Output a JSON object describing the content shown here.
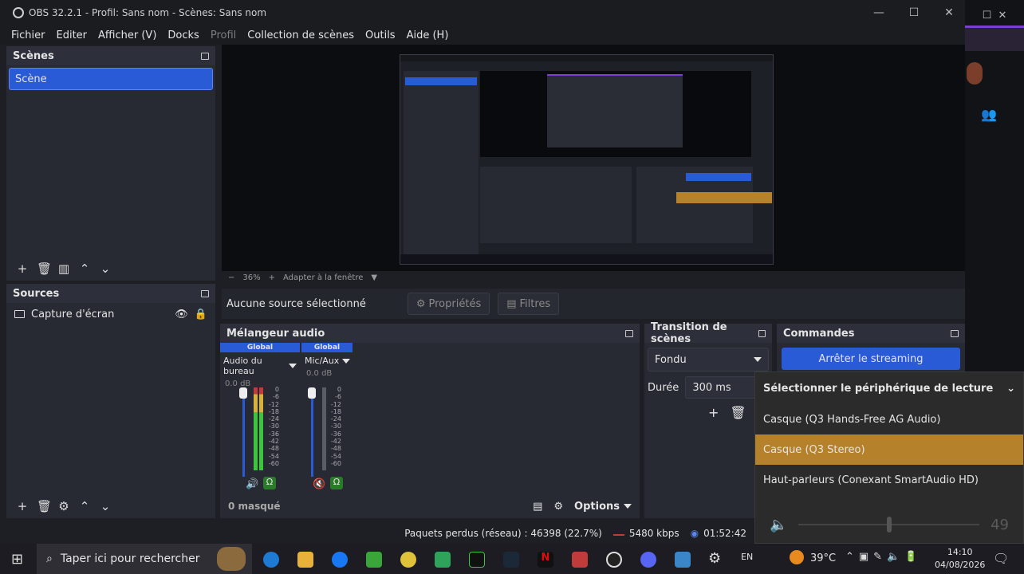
{
  "window": {
    "title": "OBS 32.2.1 - Profil: Sans nom - Scènes: Sans nom",
    "controls": [
      "—",
      "☐",
      "✕"
    ]
  },
  "menu": [
    "Fichier",
    "Editer",
    "Afficher (V)",
    "Docks",
    "Profil",
    "Collection de scènes",
    "Outils",
    "Aide (H)"
  ],
  "scenes": {
    "title": "Scènes",
    "items": [
      "Scène"
    ]
  },
  "sources": {
    "title": "Sources",
    "items": [
      "Capture d'écran"
    ]
  },
  "preview": {
    "zoom": "36%",
    "fit_label": "Adapter à la fenêtre"
  },
  "context": {
    "no_source": "Aucune source sélectionné",
    "properties": "Propriétés",
    "filters": "Filtres"
  },
  "mixer": {
    "title": "Mélangeur audio",
    "channels": [
      {
        "strip": "Global",
        "name": "Audio du bureau",
        "db": "0.0 dB"
      },
      {
        "strip": "Global",
        "name": "Mic/Aux",
        "db": "0.0 dB"
      }
    ],
    "scale": [
      "0",
      "-6",
      "-12",
      "-18",
      "-24",
      "-30",
      "-36",
      "-42",
      "-48",
      "-54",
      "-60"
    ],
    "hidden": "0 masqué",
    "options": "Options"
  },
  "transition": {
    "title": "Transition de scènes",
    "type": "Fondu",
    "duration_label": "Durée",
    "duration": "300 ms"
  },
  "controls": {
    "title": "Commandes",
    "stream_button": "Arrêter le streaming"
  },
  "status": {
    "dropped": "Paquets perdus (réseau) : 46398 (22.7%)",
    "bitrate": "5480 kbps",
    "time": "01:52:42"
  },
  "audio_popup": {
    "title": "Sélectionner le périphérique de lecture",
    "devices": [
      "Casque (Q3 Hands-Free AG Audio)",
      "Casque (Q3 Stereo)",
      "Haut-parleurs (Conexant SmartAudio HD)"
    ],
    "selected_index": 1,
    "volume": "49"
  },
  "taskbar": {
    "search_placeholder": "Taper ici pour rechercher",
    "lang": "EN",
    "temperature": "39°C",
    "clock_time": "14:10",
    "clock_date": "04/08/2026"
  },
  "colors": {
    "accent": "#2a5bd6",
    "highlight": "#b5812a",
    "meter": "#3cc63c"
  }
}
